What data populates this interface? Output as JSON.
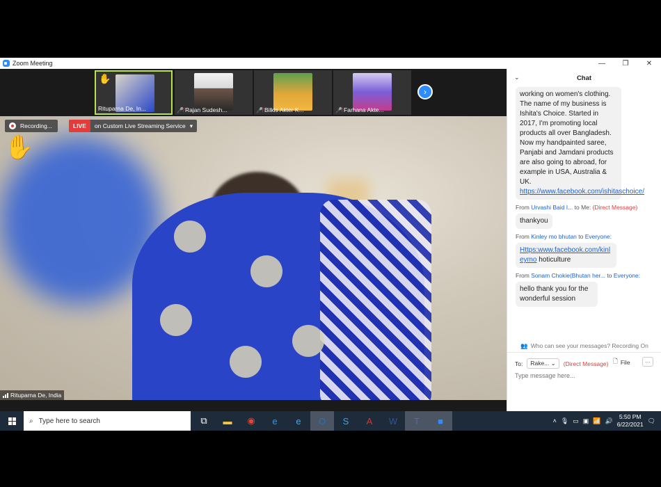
{
  "window": {
    "title": "Zoom Meeting",
    "controls": [
      "—",
      "❐",
      "✕"
    ]
  },
  "gallery": [
    {
      "name": "Rituparna De, In...",
      "muted": false,
      "active": true,
      "hand": "✋",
      "color": "#2b48c9"
    },
    {
      "name": "Rajan Sudesh...",
      "muted": true,
      "active": false,
      "color": "#e9e9e9"
    },
    {
      "name": "Bilkis Akter K...",
      "muted": true,
      "active": false,
      "color": "#3f8a3a"
    },
    {
      "name": "Farhana Akte...",
      "muted": true,
      "active": false,
      "color": "#6b4fd0"
    }
  ],
  "recording": {
    "label": "Recording..."
  },
  "live": {
    "tag": "LIVE",
    "text": "on Custom Live Streaming Service",
    "caret": "▾"
  },
  "main_video": {
    "name": "Rituparna De, India",
    "hand": "✋"
  },
  "chat": {
    "title": "Chat",
    "collapse": "⌄",
    "first_message": "working on women's clothing. The name of my business is Ishita's Choice. Started in 2017, I'm promoting local products all over Bangladesh. Now my handpainted saree, Panjabi and Jamdani products are also going to abroad, for example in USA, Australia & UK.",
    "first_link": "https://www.facebook.com/ishitaschoice/",
    "messages": [
      {
        "from": "Urvashi Baid I...",
        "to": "Me:",
        "dm": "(Direct Message)",
        "text": "thankyou",
        "link": ""
      },
      {
        "from": "Kinley mo bhutan",
        "to": "Everyone:",
        "dm": "",
        "text": " hoticulture",
        "link": "Https:www.facebook.com/kinleymo"
      },
      {
        "from": "Sonam Chokie(Bhutan her...",
        "to": "Everyone:",
        "dm": "",
        "text": "hello thank you for the wonderful session",
        "link": ""
      }
    ],
    "labels": {
      "from": "From",
      "to": "to"
    },
    "visibility": "Who can see your messages? Recording On",
    "to_label": "To:",
    "to_value": "Rake...",
    "to_dm": "(Direct Message)",
    "file_label": "File",
    "more_label": "···",
    "input_placeholder": "Type message here..."
  },
  "taskbar": {
    "search_placeholder": "Type here to search",
    "icons": [
      {
        "name": "task-view-icon",
        "glyph": "⧉",
        "color": "#ffffff"
      },
      {
        "name": "file-explorer-icon",
        "glyph": "▬",
        "color": "#f4c542"
      },
      {
        "name": "chrome-icon",
        "glyph": "◉",
        "color": "#e94335"
      },
      {
        "name": "edge-icon",
        "glyph": "e",
        "color": "#2f9be8"
      },
      {
        "name": "internet-explorer-icon",
        "glyph": "e",
        "color": "#43a9ea"
      },
      {
        "name": "outlook-icon",
        "glyph": "O",
        "color": "#1c75c9"
      },
      {
        "name": "skype-icon",
        "glyph": "S",
        "color": "#3aa7e3"
      },
      {
        "name": "acrobat-icon",
        "glyph": "A",
        "color": "#d9332f"
      },
      {
        "name": "word-icon",
        "glyph": "W",
        "color": "#2b5797"
      },
      {
        "name": "teams-icon",
        "glyph": "T",
        "color": "#6264a7"
      },
      {
        "name": "zoom-icon",
        "glyph": "■",
        "color": "#2d8cff"
      }
    ],
    "time": "5:50 PM",
    "date": "6/22/2021"
  }
}
